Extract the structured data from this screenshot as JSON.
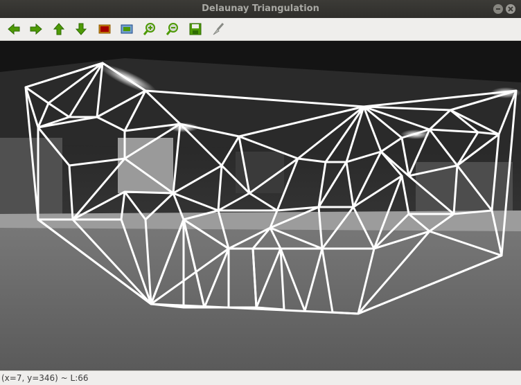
{
  "window": {
    "title": "Delaunay Triangulation"
  },
  "toolbar": {
    "tools": [
      {
        "icon": "arrow-left-icon",
        "name": "pan-left-button"
      },
      {
        "icon": "arrow-right-icon",
        "name": "pan-right-button"
      },
      {
        "icon": "arrow-up-icon",
        "name": "pan-up-button"
      },
      {
        "icon": "arrow-down-icon",
        "name": "pan-down-button"
      },
      {
        "icon": "image-icon",
        "name": "zoom-original-button"
      },
      {
        "icon": "zoom-fit-icon",
        "name": "zoom-fit-button"
      },
      {
        "icon": "zoom-in-icon",
        "name": "zoom-in-button"
      },
      {
        "icon": "zoom-out-icon",
        "name": "zoom-out-button"
      },
      {
        "icon": "save-icon",
        "name": "save-button"
      },
      {
        "icon": "properties-brush-icon",
        "name": "properties-button"
      }
    ]
  },
  "status": {
    "text": "(x=7, y=346) ~ L:66"
  },
  "colors": {
    "toolbar_bg": "#efeeec",
    "icon_green": "#4e9a06",
    "icon_orange": "#f57900",
    "mesh_line": "#ffffff"
  }
}
